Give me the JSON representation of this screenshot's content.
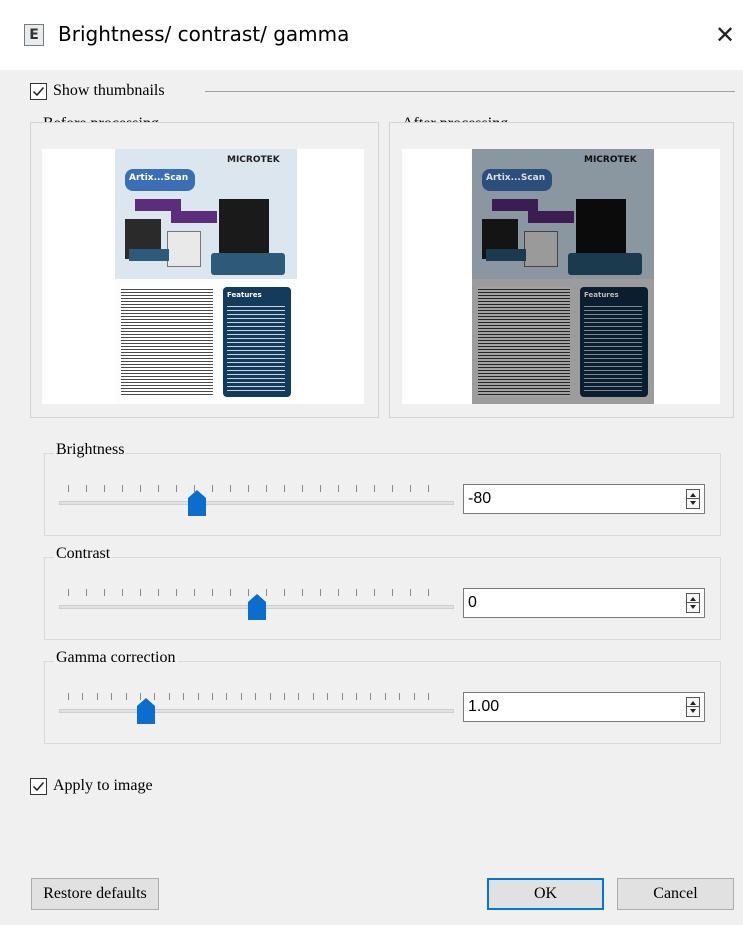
{
  "window": {
    "title": "Brightness/ contrast/ gamma",
    "icon_letter": "E",
    "icon": "app-icon",
    "close": "✕"
  },
  "thumbnails": {
    "checked": true,
    "label": "Show thumbnails",
    "before_title": "Before processing",
    "after_title": "After processing"
  },
  "brochure": {
    "brand": "MICROTEK",
    "product": "Artix...Scan",
    "features_heading": "Features"
  },
  "sliders": [
    {
      "title": "Brightness",
      "value": "-80",
      "fraction": 0.35
    },
    {
      "title": "Contrast",
      "value": "0",
      "fraction": 0.5
    },
    {
      "title": "Gamma correction",
      "value": "1.00",
      "fraction": 0.22
    }
  ],
  "apply": {
    "checked": true,
    "label": "Apply to image"
  },
  "buttons": {
    "restore": "Restore defaults",
    "ok": "OK",
    "cancel": "Cancel"
  },
  "colors": {
    "accent": "#0078d7",
    "thumb": "#0a6ed1"
  }
}
